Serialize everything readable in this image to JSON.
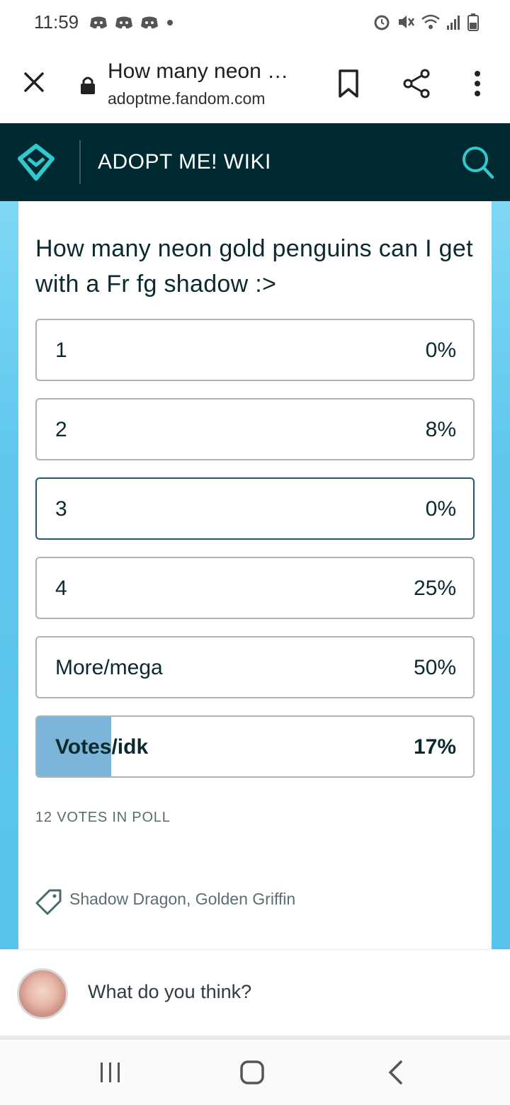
{
  "status_bar": {
    "time": "11:59"
  },
  "browser": {
    "title": "How many neon …",
    "url": "adoptme.fandom.com"
  },
  "wiki": {
    "name": "ADOPT ME! WIKI"
  },
  "poll": {
    "question": "How many neon gold penguins can I get with a Fr fg shadow :>",
    "options": [
      {
        "label": "1",
        "percent": "0%"
      },
      {
        "label": "2",
        "percent": "8%"
      },
      {
        "label": "3",
        "percent": "0%"
      },
      {
        "label": "4",
        "percent": "25%"
      },
      {
        "label": "More/mega",
        "percent": "50%"
      },
      {
        "label": "Votes/idk",
        "percent": "17%",
        "fill_fraction": 0.17
      }
    ],
    "votes_text": "12 VOTES IN POLL"
  },
  "tags": {
    "text": "Shadow Dragon, Golden Griffin"
  },
  "comment": {
    "placeholder": "What do you think?"
  },
  "colors": {
    "header_bg": "#002a32",
    "accent": "#33c9cc",
    "poll_fill": "#7db5d8"
  },
  "icons": [
    "close-icon",
    "lock-icon",
    "bookmark-icon",
    "share-icon",
    "more-vert-icon",
    "fandom-logo-icon",
    "search-icon",
    "tag-icon",
    "recent-apps-icon",
    "home-icon",
    "back-icon"
  ]
}
